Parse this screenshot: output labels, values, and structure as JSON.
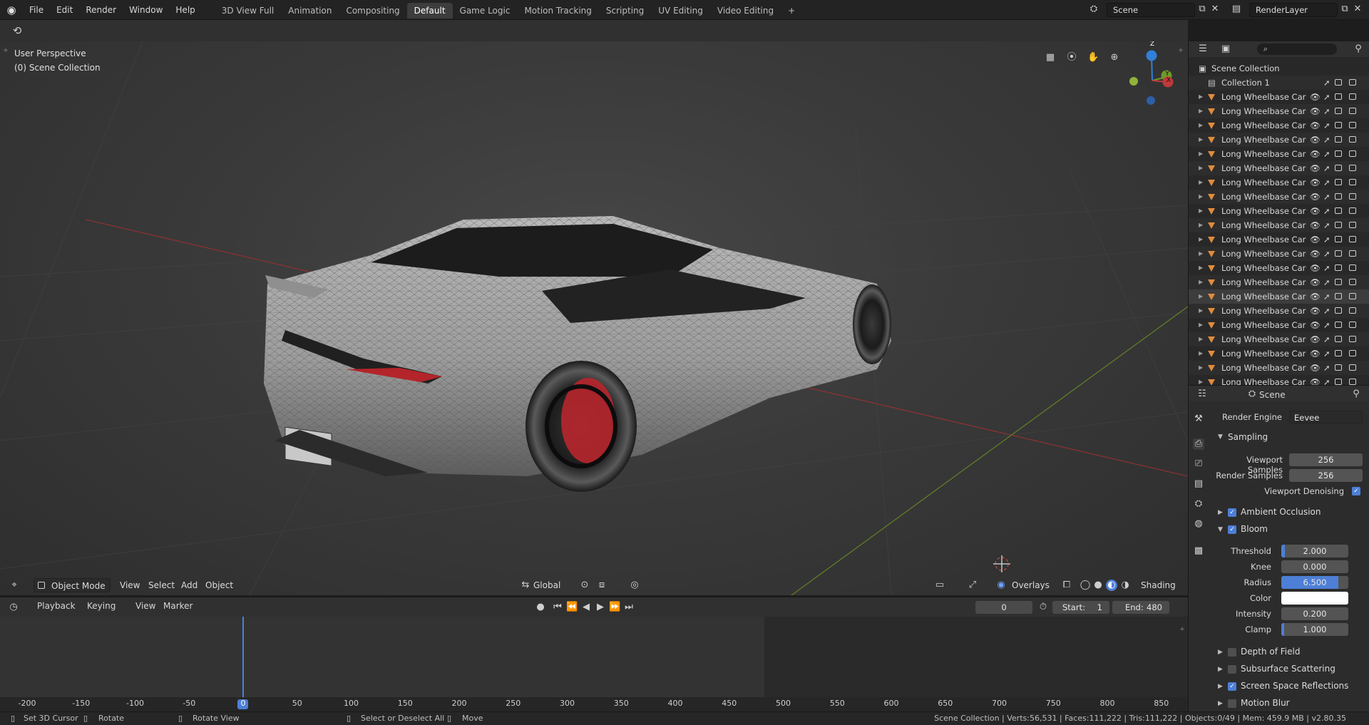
{
  "menu": [
    "File",
    "Edit",
    "Render",
    "Window",
    "Help"
  ],
  "workspaces": [
    "3D View Full",
    "Animation",
    "Compositing",
    "Default",
    "Game Logic",
    "Motion Tracking",
    "Scripting",
    "UV Editing",
    "Video Editing",
    "+"
  ],
  "scene_field": "Scene",
  "renderlayer_field": "RenderLayer",
  "viewport": {
    "perspective": "User Perspective",
    "collection": "(0) Scene Collection"
  },
  "vp_header": {
    "mode": "Object Mode",
    "view": "View",
    "select": "Select",
    "add": "Add",
    "object": "Object",
    "orientation": "Global",
    "overlays": "Overlays",
    "shading": "Shading"
  },
  "gizmo": {
    "x": "X",
    "y": "Y",
    "z": "Z"
  },
  "timeline": {
    "playback": "Playback",
    "keying": "Keying",
    "view": "View",
    "marker": "Marker",
    "current": "0",
    "start_label": "Start:",
    "start": "1",
    "end_label": "End:",
    "end": "480"
  },
  "ruler_ticks": [
    "-200",
    "-150",
    "-100",
    "-50",
    "0",
    "50",
    "100",
    "150",
    "200",
    "250",
    "300",
    "350",
    "400",
    "450",
    "500",
    "550",
    "600",
    "650",
    "700",
    "750",
    "800",
    "850"
  ],
  "status": {
    "cursor": "Set 3D Cursor",
    "rotate": "Rotate",
    "rotate_view": "Rotate View",
    "select": "Select or Deselect All",
    "move": "Move",
    "stats": "Scene Collection | Verts:56,531 | Faces:111,222 | Tris:111,222 | Objects:0/49 | Mem: 459.9 MB | v2.80.35"
  },
  "outliner": {
    "root": "Scene Collection",
    "collection": "Collection 1",
    "object_label": "Long Wheelbase Car",
    "object_count": 21,
    "selected_index": 14
  },
  "props": {
    "context": "Scene",
    "render_engine_label": "Render Engine",
    "render_engine": "Eevee",
    "sampling": "Sampling",
    "viewport_samples_label": "Viewport Samples",
    "viewport_samples": "256",
    "render_samples_label": "Render Samples",
    "render_samples": "256",
    "denoise_label": "Viewport Denoising",
    "ao": "Ambient Occlusion",
    "bloom": "Bloom",
    "threshold_label": "Threshold",
    "threshold": "2.000",
    "threshold_fill": 0.05,
    "knee_label": "Knee",
    "knee": "0.000",
    "radius_label": "Radius",
    "radius": "6.500",
    "radius_fill": 0.85,
    "color_label": "Color",
    "bloom_color": "#ffffff",
    "intensity_label": "Intensity",
    "intensity": "0.200",
    "clamp_label": "Clamp",
    "clamp": "1.000",
    "clamp_fill": 0.04,
    "dof": "Depth of Field",
    "sss": "Subsurface Scattering",
    "ssr": "Screen Space Reflections",
    "motion_blur": "Motion Blur"
  },
  "colors": {
    "accent": "#4d7fd6",
    "object_icon": "#e08b3c",
    "x_axis": "#c0393b",
    "y_axis": "#6f9a2a",
    "z_axis": "#2f80d8"
  }
}
